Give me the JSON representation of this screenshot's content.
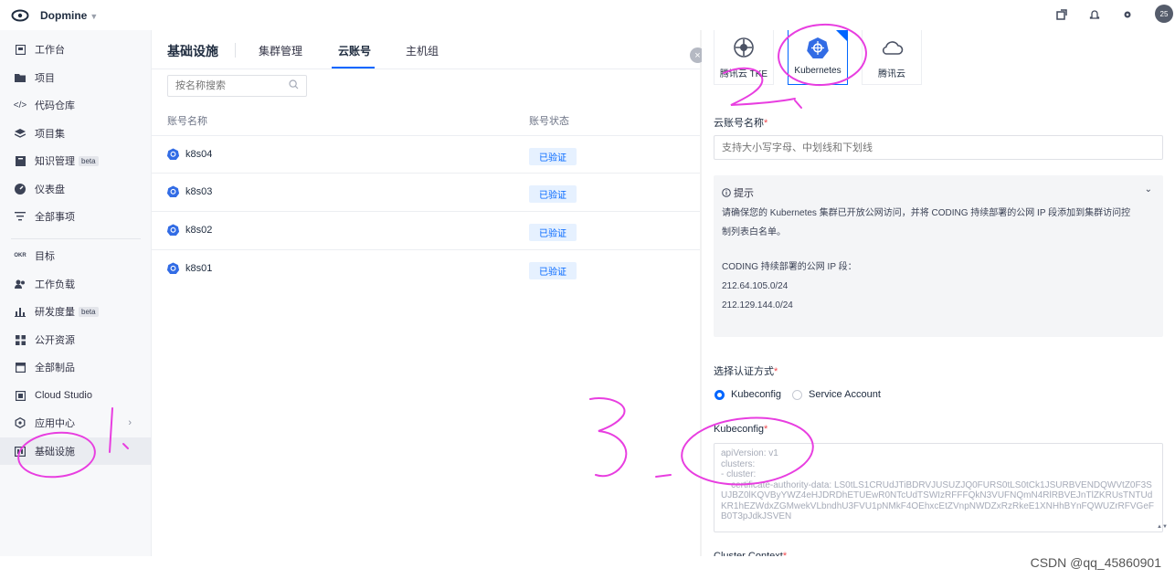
{
  "topbar": {
    "team_name": "Dopmine",
    "avatar_text": "25"
  },
  "sidebar": {
    "items": [
      {
        "label": "工作台",
        "icon": "monitor-icon"
      },
      {
        "label": "项目",
        "icon": "folder-icon"
      },
      {
        "label": "代码仓库",
        "icon": "code-icon"
      },
      {
        "label": "项目集",
        "icon": "layers-icon"
      },
      {
        "label": "知识管理",
        "icon": "book-icon",
        "badge": "beta"
      },
      {
        "label": "仪表盘",
        "icon": "dashboard-icon"
      },
      {
        "label": "全部事项",
        "icon": "list-icon"
      },
      {
        "label": "目标",
        "icon": "okr-icon"
      },
      {
        "label": "工作负载",
        "icon": "users-icon"
      },
      {
        "label": "研发度量",
        "icon": "bar-chart-icon",
        "badge": "beta"
      },
      {
        "label": "公开资源",
        "icon": "grid-icon"
      },
      {
        "label": "全部制品",
        "icon": "box-icon"
      },
      {
        "label": "Cloud Studio",
        "icon": "studio-icon"
      },
      {
        "label": "应用中心",
        "icon": "hexagon-icon"
      },
      {
        "label": "基础设施",
        "icon": "infrastructure-icon"
      }
    ]
  },
  "main": {
    "title": "基础设施",
    "tabs": [
      {
        "label": "集群管理"
      },
      {
        "label": "云账号"
      },
      {
        "label": "主机组"
      }
    ],
    "search_placeholder": "按名称搜索",
    "columns": [
      "账号名称",
      "账号状态"
    ],
    "rows": [
      {
        "name": "k8s04",
        "status": "已验证"
      },
      {
        "name": "k8s03",
        "status": "已验证"
      },
      {
        "name": "k8s02",
        "status": "已验证"
      },
      {
        "name": "k8s01",
        "status": "已验证"
      }
    ]
  },
  "drawer": {
    "providers": [
      {
        "label": "腾讯云 TKE"
      },
      {
        "label": "Kubernetes"
      },
      {
        "label": "腾讯云"
      }
    ],
    "account_name_label": "云账号名称",
    "account_name_placeholder": "支持大小写字母、中划线和下划线",
    "tip": {
      "title": "提示",
      "line1": "请确保您的 Kubernetes 集群已开放公网访问，并将 CODING 持续部署的公网 IP 段添加到集群访问控",
      "line2": "制列表白名单。",
      "line3": "CODING 持续部署的公网 IP 段：",
      "ip1": "212.64.105.0/24",
      "ip2": "212.129.144.0/24"
    },
    "auth_label": "选择认证方式",
    "auth_options": [
      {
        "label": "Kubeconfig",
        "checked": true
      },
      {
        "label": "Service Account",
        "checked": false
      }
    ],
    "kubeconfig_label": "Kubeconfig",
    "kubeconfig_value": "apiVersion: v1\nclusters:\n- cluster:\n    certificate-authority-data: LS0tLS1CRUdJTiBDRVJUSUZJQ0FURS0tLS0tCk1JSURBVENDQWVtZ0F3SUJBZ0lKQVByYWZ4eHJDRDhETUEwR0NTcUdTSWIzRFFFQkN3VUFNQmN4RlRBVEJnTlZKRUsTNTUdKR1hEZWdxZGMwekVLbndhU3FVU1pNMkF4OEhxcEtZVnpNWDZxRzRkeE1XNHhBYnFQWUZrRFVGeFB0T3pJdkJSVEN",
    "next_field_label": "Cluster Context"
  },
  "watermark": "CSDN @qq_45860901",
  "annotations": [
    "1",
    "2",
    "3"
  ]
}
